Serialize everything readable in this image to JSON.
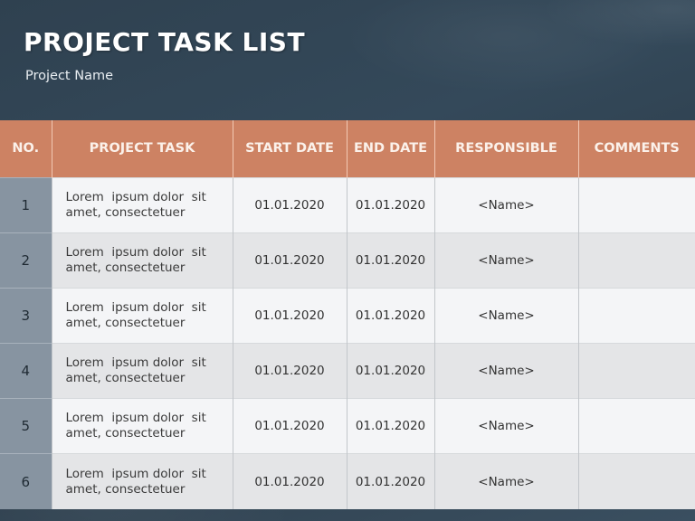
{
  "header": {
    "title": "PROJECT TASK LIST",
    "subtitle": "Project Name"
  },
  "colors": {
    "header_bg": "#cd8263",
    "number_column_bg": "#8794a1",
    "slide_bg": "#34495a"
  },
  "table": {
    "columns": [
      "NO.",
      "PROJECT TASK",
      "START DATE",
      "END DATE",
      "RESPONSIBLE",
      "COMMENTS"
    ],
    "rows": [
      {
        "no": "1",
        "task_line1": "Lorem  ipsum dolor  sit",
        "task_line2": "amet, consectetuer",
        "start": "01.01.2020",
        "end": "01.01.2020",
        "responsible": "<Name>",
        "comments": ""
      },
      {
        "no": "2",
        "task_line1": "Lorem  ipsum dolor  sit",
        "task_line2": "amet, consectetuer",
        "start": "01.01.2020",
        "end": "01.01.2020",
        "responsible": "<Name>",
        "comments": ""
      },
      {
        "no": "3",
        "task_line1": "Lorem  ipsum dolor  sit",
        "task_line2": "amet, consectetuer",
        "start": "01.01.2020",
        "end": "01.01.2020",
        "responsible": "<Name>",
        "comments": ""
      },
      {
        "no": "4",
        "task_line1": "Lorem  ipsum dolor  sit",
        "task_line2": "amet, consectetuer",
        "start": "01.01.2020",
        "end": "01.01.2020",
        "responsible": "<Name>",
        "comments": ""
      },
      {
        "no": "5",
        "task_line1": "Lorem  ipsum dolor  sit",
        "task_line2": "amet, consectetuer",
        "start": "01.01.2020",
        "end": "01.01.2020",
        "responsible": "<Name>",
        "comments": ""
      },
      {
        "no": "6",
        "task_line1": "Lorem  ipsum dolor  sit",
        "task_line2": "amet, consectetuer",
        "start": "01.01.2020",
        "end": "01.01.2020",
        "responsible": "<Name>",
        "comments": ""
      }
    ]
  }
}
